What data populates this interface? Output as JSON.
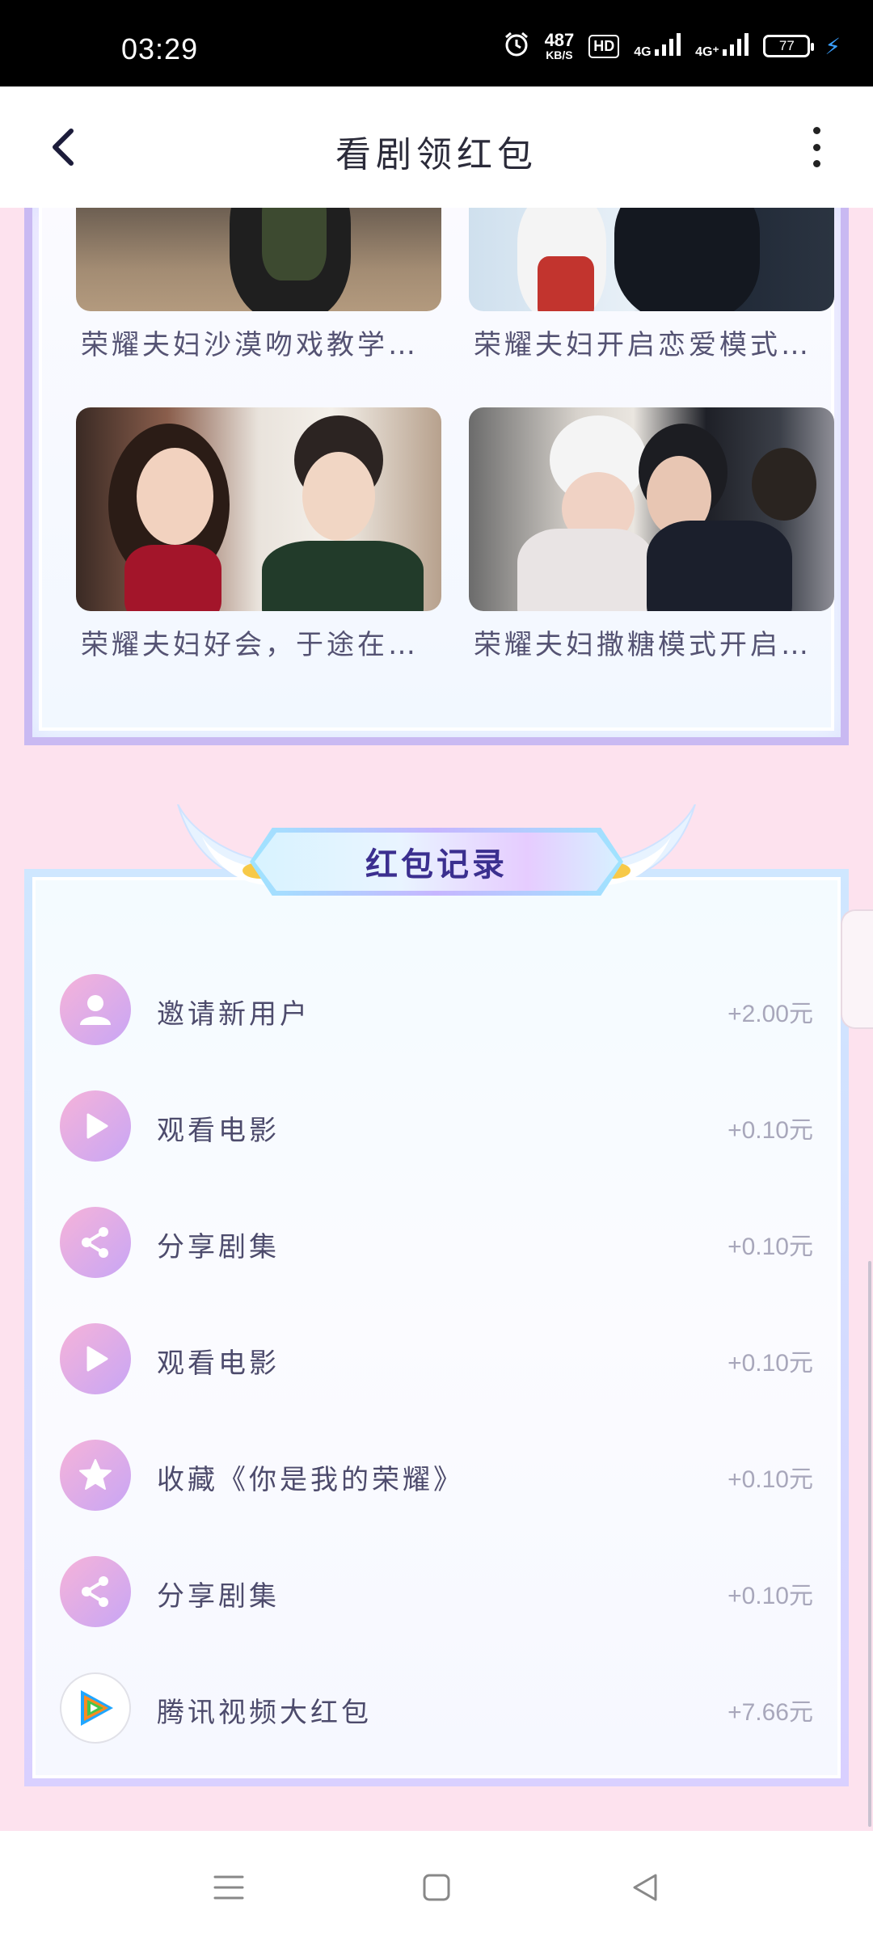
{
  "status_bar": {
    "time": "03:29",
    "net_speed_value": "487",
    "net_speed_unit": "KB/S",
    "hd_label": "HD",
    "signal1_label": "4G",
    "signal2_label": "4G⁺",
    "battery_level": "77"
  },
  "header": {
    "title": "看剧领红包"
  },
  "videos": [
    {
      "title": "荣耀夫妇沙漠吻戏教学…"
    },
    {
      "title": "荣耀夫妇开启恋爱模式…"
    },
    {
      "title": "荣耀夫妇好会，于途在…"
    },
    {
      "title": "荣耀夫妇撒糖模式开启…"
    }
  ],
  "records": {
    "title": "红包记录",
    "items": [
      {
        "icon": "user-icon",
        "label": "邀请新用户",
        "amount": "+2.00元"
      },
      {
        "icon": "play-icon",
        "label": "观看电影",
        "amount": "+0.10元"
      },
      {
        "icon": "share-icon",
        "label": "分享剧集",
        "amount": "+0.10元"
      },
      {
        "icon": "play-icon",
        "label": "观看电影",
        "amount": "+0.10元"
      },
      {
        "icon": "star-icon",
        "label": "收藏《你是我的荣耀》",
        "amount": "+0.10元"
      },
      {
        "icon": "share-icon",
        "label": "分享剧集",
        "amount": "+0.10元"
      },
      {
        "icon": "tencent-video-icon",
        "label": "腾讯视频大红包",
        "amount": "+7.66元"
      }
    ]
  },
  "colors": {
    "page_background": "#fde2ee",
    "panel_border": "#c9b9f2",
    "record_title": "#3b2f8f",
    "amount_text": "#a8a7bb",
    "icon_gradient_start": "#f6b3d9",
    "icon_gradient_end": "#c8a6f5"
  }
}
